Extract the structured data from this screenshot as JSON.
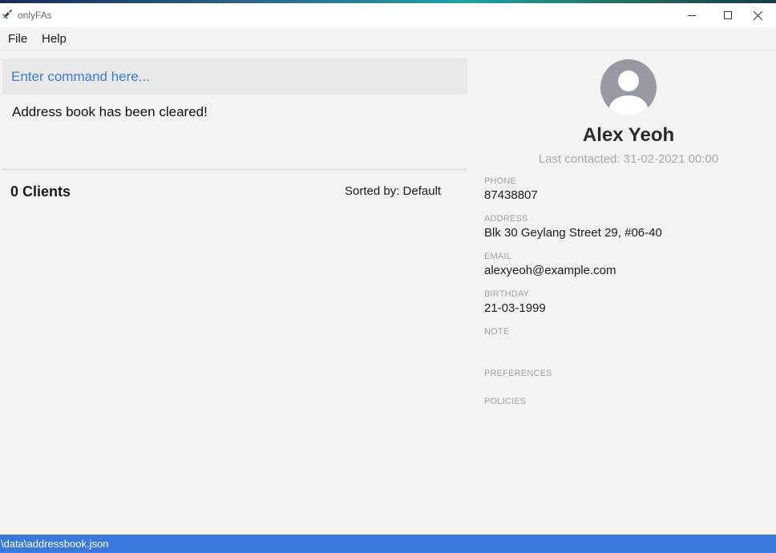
{
  "window": {
    "title": "onlyFAs",
    "app_icon": "rocket-icon",
    "controls": [
      "minimize-icon",
      "maximize-icon",
      "close-icon"
    ]
  },
  "menu": {
    "file": "File",
    "help": "Help"
  },
  "command": {
    "placeholder": "Enter command here...",
    "value": ""
  },
  "result": {
    "message": "Address book has been cleared!"
  },
  "client_list": {
    "count_label": "0 Clients",
    "sorted_by": "Sorted by: Default"
  },
  "profile": {
    "avatar_icon": "user-avatar-icon",
    "name": "Alex Yeoh",
    "last_contacted": "Last contacted: 31-02-2021 00:00",
    "fields": {
      "phone_label": "PHONE",
      "phone": "87438807",
      "address_label": "ADDRESS",
      "address": "Blk 30 Geylang Street 29, #06-40",
      "email_label": "EMAIL",
      "email": "alexyeoh@example.com",
      "birthday_label": "BIRTHDAY",
      "birthday": "21-03-1999",
      "note_label": "NOTE",
      "preferences_label": "PREFERENCES",
      "policies_label": "POLICIES"
    }
  },
  "status": {
    "path": "\\data\\addressbook.json"
  },
  "colors": {
    "accent": "#3b78dc",
    "command_text": "#3d7bd6",
    "background": "#f3f3f3"
  }
}
